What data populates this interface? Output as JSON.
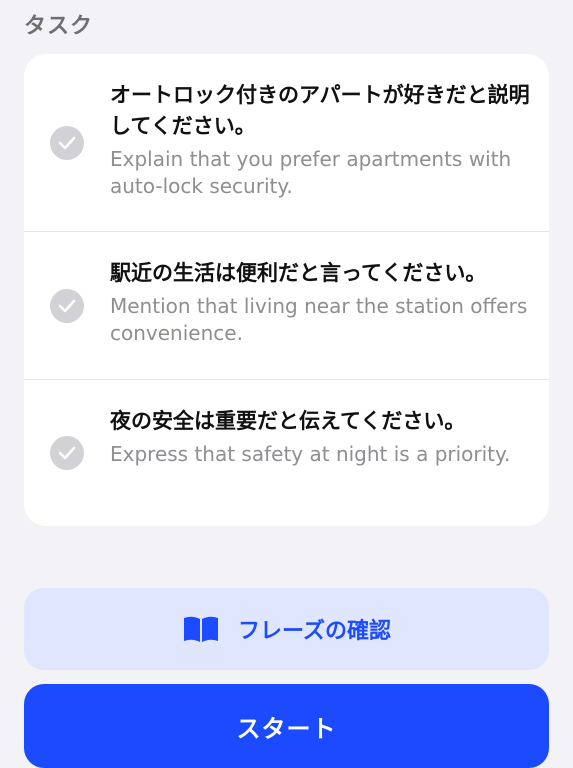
{
  "section": {
    "title": "タスク"
  },
  "tasks": [
    {
      "jp": "オートロック付きのアパートが好きだと説明してください。",
      "en": "Explain that you prefer apartments with auto-lock security.",
      "icon": "check-circle-icon",
      "completed": false
    },
    {
      "jp": "駅近の生活は便利だと言ってください。",
      "en": "Mention that living near the station offers convenience.",
      "icon": "check-circle-icon",
      "completed": false
    },
    {
      "jp": "夜の安全は重要だと伝えてください。",
      "en": "Express that safety at night is a priority.",
      "icon": "check-circle-icon",
      "completed": false
    }
  ],
  "buttons": {
    "phrases": {
      "label": "フレーズの確認",
      "icon": "open-book-icon"
    },
    "start": {
      "label": "スタート"
    }
  },
  "colors": {
    "background": "#f2f2f7",
    "card": "#ffffff",
    "accent": "#1c4bff",
    "secondary_button": "#dfe6fd",
    "check_inactive": "#d1d1d6"
  }
}
